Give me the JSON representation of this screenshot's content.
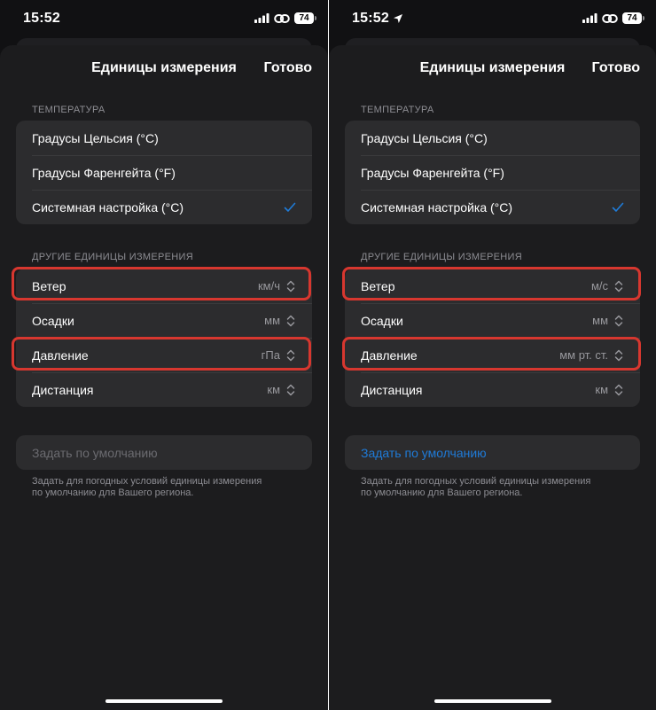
{
  "colors": {
    "background": "#111113",
    "sheet": "#1c1c1e",
    "group": "#2c2c2e",
    "accent_blue": "#1f7bd8",
    "secondary_text": "#98989d",
    "highlight_red": "#d7372f"
  },
  "screens": [
    {
      "status": {
        "time": "15:52",
        "battery": "74"
      },
      "nav": {
        "title": "Единицы измерения",
        "done": "Готово"
      },
      "temperature": {
        "header": "ТЕМПЕРАТУРА",
        "options": [
          "Градусы Цельсия (°C)",
          "Градусы Фаренгейта (°F)",
          "Системная настройка (°C)"
        ],
        "selected_index": 2
      },
      "other_units": {
        "header": "ДРУГИЕ ЕДИНИЦЫ ИЗМЕРЕНИЯ",
        "rows": [
          {
            "label": "Ветер",
            "value": "км/ч"
          },
          {
            "label": "Осадки",
            "value": "мм"
          },
          {
            "label": "Давление",
            "value": "гПа"
          },
          {
            "label": "Дистанция",
            "value": "км"
          }
        ]
      },
      "default_button": {
        "label": "Задать по умолчанию",
        "enabled": false
      },
      "footnote": [
        "Задать для погодных условий единицы измерения",
        "по умолчанию для Вашего региона."
      ]
    },
    {
      "status": {
        "time": "15:52",
        "battery": "74"
      },
      "nav": {
        "title": "Единицы измерения",
        "done": "Готово"
      },
      "temperature": {
        "header": "ТЕМПЕРАТУРА",
        "options": [
          "Градусы Цельсия (°C)",
          "Градусы Фаренгейта (°F)",
          "Системная настройка (°C)"
        ],
        "selected_index": 2
      },
      "other_units": {
        "header": "ДРУГИЕ ЕДИНИЦЫ ИЗМЕРЕНИЯ",
        "rows": [
          {
            "label": "Ветер",
            "value": "м/с"
          },
          {
            "label": "Осадки",
            "value": "мм"
          },
          {
            "label": "Давление",
            "value": "мм рт. ст."
          },
          {
            "label": "Дистанция",
            "value": "км"
          }
        ]
      },
      "default_button": {
        "label": "Задать по умолчанию",
        "enabled": true
      },
      "footnote": [
        "Задать для погодных условий единицы измерения",
        "по умолчанию для Вашего региона."
      ]
    }
  ]
}
